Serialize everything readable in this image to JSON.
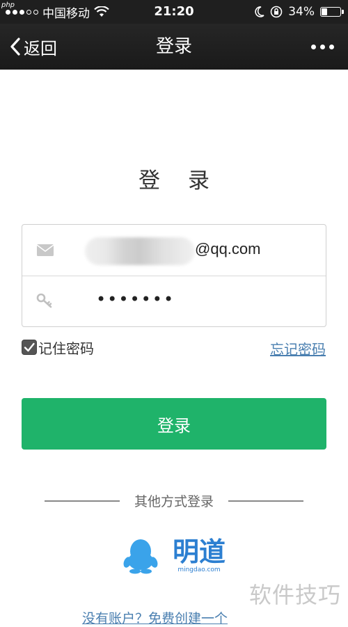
{
  "status_bar": {
    "carrier": "中国移动",
    "time": "21:20",
    "battery": "34%",
    "badge": "php",
    "battery_level": 0.34
  },
  "nav": {
    "back_label": "返回",
    "title": "登录",
    "more_icon": "more-dots-icon"
  },
  "page": {
    "heading": "登录"
  },
  "form": {
    "email_icon": "envelope-icon",
    "email_value": "@qq.com",
    "password_icon": "key-icon",
    "password_value": "•••••••",
    "remember_label": "记住密码",
    "remember_checked": true,
    "forgot_label": "忘记密码"
  },
  "actions": {
    "login_label": "登录"
  },
  "other": {
    "divider_label": "其他方式登录",
    "qq_icon": "qq-penguin-icon",
    "mingdao_label": "明道",
    "mingdao_url": "mingdao.com",
    "register_label": "没有账户？免费创建一个"
  },
  "watermark": "软件技巧",
  "colors": {
    "primary_green": "#1fb36a",
    "link_blue": "#4a7fb0",
    "nav_bg": "#1f1f1f",
    "brand_blue": "#2c7fd1"
  }
}
